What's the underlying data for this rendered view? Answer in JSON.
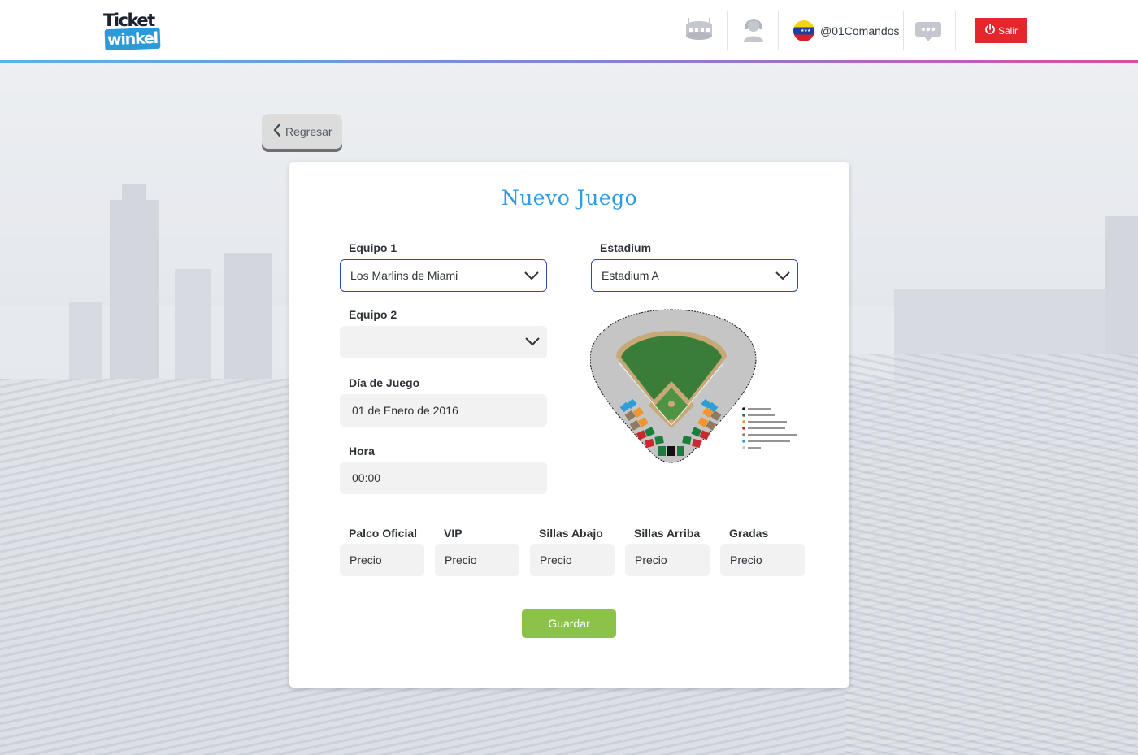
{
  "header": {
    "logo_line1": "Ticket",
    "logo_line2": "winkel",
    "username": "@01Comandos",
    "logout_label": "Salir"
  },
  "back_label": "Regresar",
  "form": {
    "title": "Nuevo Juego",
    "team1": {
      "label": "Equipo 1",
      "value": "Los Marlins de Miami"
    },
    "stadium": {
      "label": "Estadium",
      "value": "Estadium A"
    },
    "team2": {
      "label": "Equipo 2",
      "value": ""
    },
    "date": {
      "label": "Día de Juego",
      "value": "01 de Enero de 2016"
    },
    "time": {
      "label": "Hora",
      "value": "00:00"
    },
    "prices": [
      {
        "label": "Palco Oficial",
        "value": "Precio"
      },
      {
        "label": "VIP",
        "value": "Precio"
      },
      {
        "label": "Sillas Abajo",
        "value": "Precio"
      },
      {
        "label": "Sillas Arriba",
        "value": "Precio"
      },
      {
        "label": "Gradas",
        "value": "Precio"
      }
    ],
    "save_label": "Guardar"
  },
  "colors": {
    "accent_title": "#2f9be0",
    "save": "#8bc34a",
    "logout": "#e5262b",
    "select_border": "#3348b8"
  }
}
